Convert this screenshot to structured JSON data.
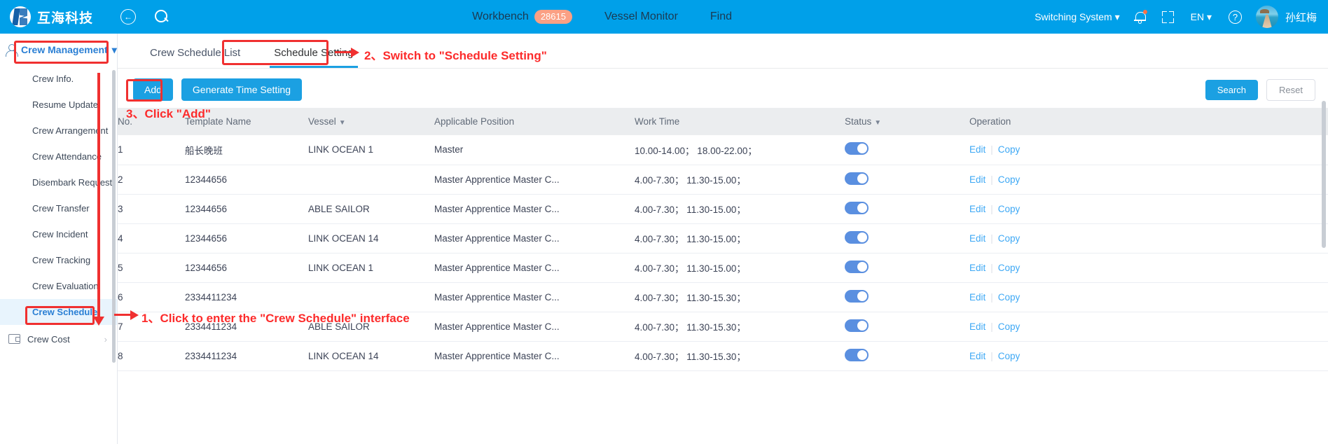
{
  "header": {
    "brand": "互海科技",
    "back_icon": "back-arrow-icon",
    "search_icon": "search-icon",
    "nav": [
      {
        "label": "Workbench",
        "badge": "28615"
      },
      {
        "label": "Vessel Monitor",
        "badge": ""
      },
      {
        "label": "Find",
        "badge": ""
      }
    ],
    "switch_system": "Switching System",
    "language": "EN",
    "user_name": "孙红梅",
    "bell_icon": "bell-icon",
    "fullscreen_icon": "fullscreen-icon",
    "help_icon": "help-icon",
    "avatar_icon": "user-avatar"
  },
  "sidebar": {
    "group_title": "Crew Management",
    "group_icon": "person-icon",
    "items": [
      {
        "label": "Crew Info.",
        "active": false
      },
      {
        "label": "Resume Update",
        "active": false
      },
      {
        "label": "Crew Arrangement",
        "active": false
      },
      {
        "label": "Crew Attendance",
        "active": false
      },
      {
        "label": "Disembark Request",
        "active": false
      },
      {
        "label": "Crew Transfer",
        "active": false
      },
      {
        "label": "Crew Incident",
        "active": false
      },
      {
        "label": "Crew Tracking",
        "active": false
      },
      {
        "label": "Crew Evaluation",
        "active": false
      },
      {
        "label": "Crew Schedule",
        "active": true
      }
    ],
    "bottom_item": {
      "label": "Crew Cost",
      "icon": "wallet-icon",
      "chevron": "›"
    }
  },
  "tabs": [
    {
      "label": "Crew Schedule List",
      "active": false
    },
    {
      "label": "Schedule Setting",
      "active": true
    }
  ],
  "toolbar": {
    "add_label": "Add",
    "generate_label": "Generate Time Setting",
    "search_label": "Search",
    "reset_label": "Reset"
  },
  "table": {
    "columns": [
      {
        "label": "No.",
        "sortable": false
      },
      {
        "label": "Template Name",
        "sortable": false
      },
      {
        "label": "Vessel",
        "sortable": true
      },
      {
        "label": "Applicable Position",
        "sortable": false
      },
      {
        "label": "Work Time",
        "sortable": false
      },
      {
        "label": "Status",
        "sortable": true
      },
      {
        "label": "Operation",
        "sortable": false
      }
    ],
    "rows": [
      {
        "no": "1",
        "template": "船长晚班",
        "template_muted": true,
        "vessel": "LINK OCEAN 1",
        "position": "Master",
        "work_time": "10.00-14.00；  18.00-22.00；",
        "status_on": true,
        "edit": "Edit",
        "copy": "Copy"
      },
      {
        "no": "2",
        "template": "12344656",
        "template_muted": false,
        "vessel": "",
        "position": "Master Apprentice Master C...",
        "work_time": "4.00-7.30；  11.30-15.00；",
        "status_on": true,
        "edit": "Edit",
        "copy": "Copy"
      },
      {
        "no": "3",
        "template": "12344656",
        "template_muted": false,
        "vessel": "ABLE SAILOR",
        "position": "Master Apprentice Master C...",
        "work_time": "4.00-7.30；  11.30-15.00；",
        "status_on": true,
        "edit": "Edit",
        "copy": "Copy"
      },
      {
        "no": "4",
        "template": "12344656",
        "template_muted": false,
        "vessel": "LINK OCEAN 14",
        "position": "Master Apprentice Master C...",
        "work_time": "4.00-7.30；  11.30-15.00；",
        "status_on": true,
        "edit": "Edit",
        "copy": "Copy"
      },
      {
        "no": "5",
        "template": "12344656",
        "template_muted": false,
        "vessel": "LINK OCEAN 1",
        "position": "Master Apprentice Master C...",
        "work_time": "4.00-7.30；  11.30-15.00；",
        "status_on": true,
        "edit": "Edit",
        "copy": "Copy"
      },
      {
        "no": "6",
        "template": "2334411234",
        "template_muted": false,
        "vessel": "",
        "position": "Master Apprentice Master C...",
        "work_time": "4.00-7.30；  11.30-15.30；",
        "status_on": true,
        "edit": "Edit",
        "copy": "Copy"
      },
      {
        "no": "7",
        "template": "2334411234",
        "template_muted": false,
        "vessel": "ABLE SAILOR",
        "position": "Master Apprentice Master C...",
        "work_time": "4.00-7.30；  11.30-15.30；",
        "status_on": true,
        "edit": "Edit",
        "copy": "Copy"
      },
      {
        "no": "8",
        "template": "2334411234",
        "template_muted": false,
        "vessel": "LINK OCEAN 14",
        "position": "Master Apprentice Master C...",
        "work_time": "4.00-7.30；  11.30-15.30；",
        "status_on": true,
        "edit": "Edit",
        "copy": "Copy"
      }
    ]
  },
  "annotations": [
    {
      "id": "step1",
      "text": "1、Click to enter the \"Crew Schedule\" interface"
    },
    {
      "id": "step2",
      "text": "2、Switch to \"Schedule Setting\""
    },
    {
      "id": "step3",
      "text": "3、Click \"Add\""
    }
  ],
  "colors": {
    "brand_blue": "#00a0e9",
    "accent_blue": "#1ba0e2",
    "annotation_red": "#fc2b2b",
    "badge_orange": "#fba084",
    "toggle_on": "#5a8fe0"
  }
}
